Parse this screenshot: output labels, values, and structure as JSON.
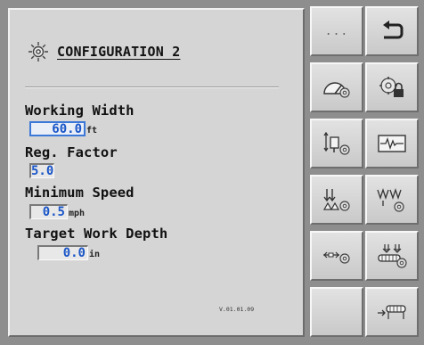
{
  "screen": {
    "title": "CONFIGURATION 2",
    "version": "V.01.01.09"
  },
  "fields": [
    {
      "label": "Working Width",
      "value": "60.0",
      "unit": "ft"
    },
    {
      "label": "Reg. Factor",
      "value": "5.0",
      "unit": ""
    },
    {
      "label": "Minimum Speed",
      "value": "0.5",
      "unit": "mph"
    },
    {
      "label": "Target Work Depth",
      "value": "0.0",
      "unit": "in"
    }
  ],
  "softkeys": {
    "more_label": "...",
    "left": [
      "more-dots-icon",
      "speed-gauge-settings-icon",
      "implement-height-settings-icon",
      "seed-delivery-settings-icon",
      "flow-settings-icon",
      ""
    ],
    "right": [
      "back-arrow-icon",
      "locked-settings-icon",
      "signal-waveform-icon",
      "downforce-settings-icon",
      "conveyor-settings-icon",
      "conveyor-input-icon"
    ]
  },
  "colors": {
    "panel": "#d5d5d5",
    "softkey_column": "#8e8e8e",
    "value_text": "#1a56c8",
    "selected_outline": "#3b78d8"
  }
}
